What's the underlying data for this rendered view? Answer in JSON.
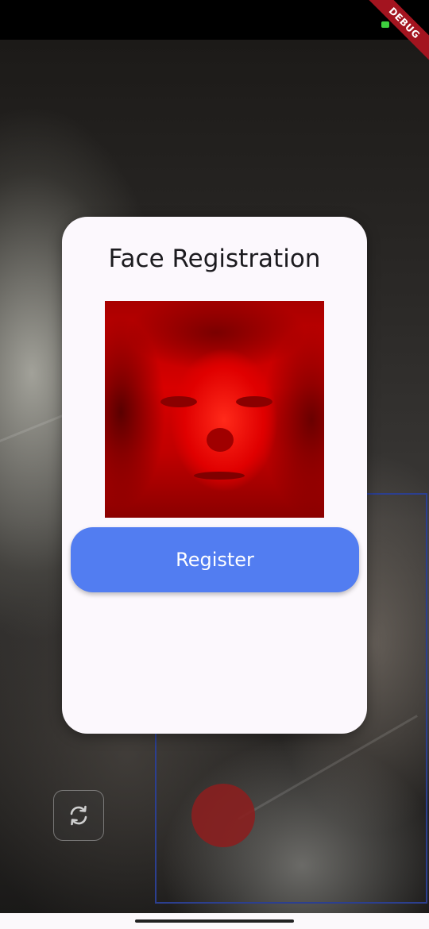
{
  "status_bar": {
    "debug_label": "DEBUG",
    "battery_icon": "battery-icon"
  },
  "dialog": {
    "title": "Face Registration",
    "face_preview_icon": "face-preview-image",
    "register_label": "Register"
  },
  "camera_controls": {
    "switch_camera_icon": "refresh-icon",
    "capture_icon": "record-circle-icon"
  },
  "colors": {
    "accent": "#527df1",
    "capture": "#8a1f1f",
    "face_box": "#2c3f8f",
    "dialog_bg": "#fcf8fd",
    "debug_ribbon": "#a3141f"
  }
}
